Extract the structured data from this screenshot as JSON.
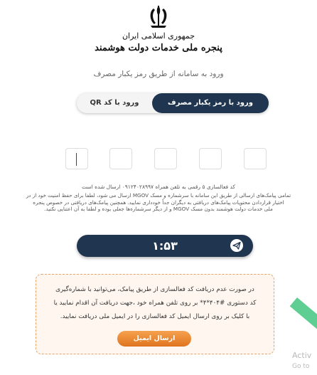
{
  "header": {
    "emblem_icon": "iran-emblem-icon",
    "brand_line1": "جمهوری اسلامی ایران",
    "brand_line2": "پنجره ملی خدمات دولت هوشمند"
  },
  "login": {
    "subtitle": "ورود به سامانه از طریق رمز یکبار مصرف",
    "tabs": [
      {
        "label": "ورود با رمز یکبار مصرف",
        "active": true
      },
      {
        "label": "ورود با کد QR",
        "active": false
      }
    ]
  },
  "otp": {
    "box_count": 5,
    "sent_message": "کد فعالسازی ۵ رقمی به تلفن همراه ۰۹۱۲۴۰۲۸۹۹۷ ارسال شده است",
    "warning": "تمامی پیامک‌های ارسالی از طریق این سامانه با سرشماره و مسک MGOV ارسال می شود، لطفا برای حفظ امنیت خود از در\nاختیار قراردادن محتویات پیامک‌های دریافتی به دیگران جداً خودداری نمایید. همچنین پیامک‌های دریافتی در خصوص پنجره\nملی خدمات دولت هوشمند بدون مسک MGOV و از دیگر سرشماره‌ها جعلی بوده و لطفا به آن اعتنایی نکنید."
  },
  "timer": {
    "value": "۱:۵۳",
    "send_icon": "paper-plane-icon"
  },
  "notice": {
    "text": "در صورت عدم دریافت کد فعالسازی از طریق پیامک، می‌توانید با شماره‌گیری\nکد دستوری #۴۰۴*۴* بر روی تلفن همراه خود ،جهت دریافت آن اقدام نمایید یا\nبا کلیک بر روی ارسال ایمیل کد فعالسازی را در ایمیل ملی دریافت نمایید.",
    "email_button": "ارسال ایمیل"
  },
  "watermark": {
    "line1": "Activ",
    "line2": "Go to"
  },
  "colors": {
    "primary": "#1f3550",
    "accent": "#ef8a34",
    "notice_bg": "#fff7ef"
  }
}
